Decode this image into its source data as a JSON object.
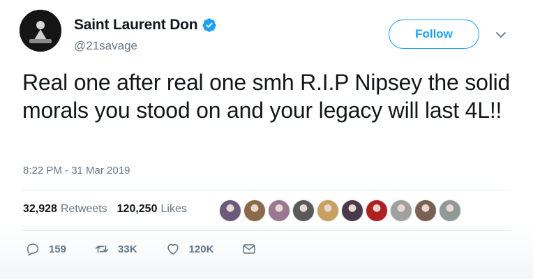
{
  "user": {
    "display_name": "Saint Laurent Don",
    "handle": "@21savage",
    "verified": true,
    "avatar_icon": "profile-avatar"
  },
  "follow_label": "Follow",
  "tweet": {
    "text": "Real one after real one smh R.I.P Nipsey the solid morals you stood on and your legacy will last 4L!!",
    "timestamp": "8:22 PM - 31 Mar 2019"
  },
  "stats": {
    "retweets_count": "32,928",
    "retweets_label": "Retweets",
    "likes_count": "120,250",
    "likes_label": "Likes"
  },
  "likers": [
    {
      "color": "#6b5a7a"
    },
    {
      "color": "#8a6a4a"
    },
    {
      "color": "#9a7890"
    },
    {
      "color": "#5a5a5a"
    },
    {
      "color": "#c8a060"
    },
    {
      "color": "#4a3a4a"
    },
    {
      "color": "#b02020"
    },
    {
      "color": "#a0a0a0"
    },
    {
      "color": "#7a6050"
    },
    {
      "color": "#909898"
    }
  ],
  "actions": {
    "reply_count": "159",
    "retweet_count": "33K",
    "like_count": "120K"
  },
  "colors": {
    "accent": "#1da1f2",
    "secondary_text": "#657786",
    "primary_text": "#14171a"
  }
}
